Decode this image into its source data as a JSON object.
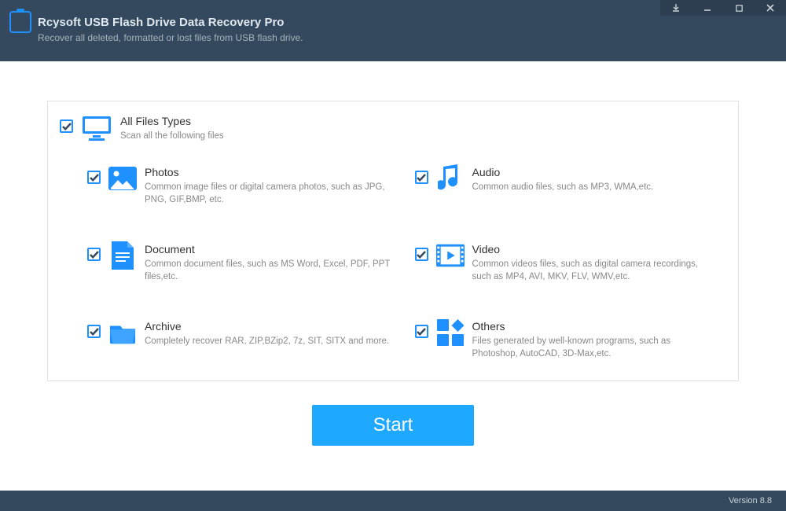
{
  "app": {
    "title": "Rcysoft USB Flash Drive Data Recovery Pro",
    "subtitle": "Recover all deleted, formatted or lost files from USB flash drive."
  },
  "all": {
    "title": "All Files Types",
    "desc": "Scan all the following files"
  },
  "photos": {
    "title": "Photos",
    "desc": "Common image files or digital camera photos, such as JPG, PNG, GIF,BMP, etc."
  },
  "audio": {
    "title": "Audio",
    "desc": "Common audio files, such as MP3, WMA,etc."
  },
  "document": {
    "title": "Document",
    "desc": "Common document files, such as MS Word, Excel, PDF, PPT files,etc."
  },
  "video": {
    "title": "Video",
    "desc": "Common videos files, such as digital camera recordings, such as MP4, AVI, MKV, FLV, WMV,etc."
  },
  "archive": {
    "title": "Archive",
    "desc": "Completely recover RAR, ZIP,BZip2, 7z, SIT, SITX and more."
  },
  "others": {
    "title": "Others",
    "desc": "Files generated by well-known programs, such as Photoshop, AutoCAD, 3D-Max,etc."
  },
  "buttons": {
    "start": "Start"
  },
  "footer": {
    "version": "Version 8.8"
  }
}
